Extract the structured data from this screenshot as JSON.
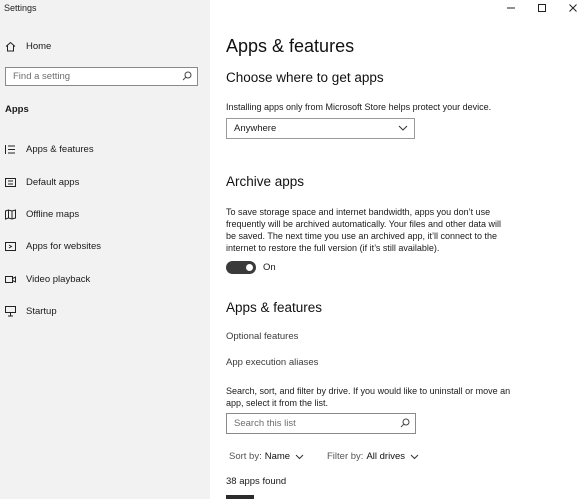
{
  "window": {
    "title": "Settings",
    "controls": [
      "minimize",
      "maximize",
      "close"
    ]
  },
  "sidebar": {
    "home_label": "Home",
    "search_placeholder": "Find a setting",
    "section_label": "Apps",
    "items": [
      {
        "label": "Apps & features",
        "icon": "list-icon"
      },
      {
        "label": "Default apps",
        "icon": "default-apps-icon"
      },
      {
        "label": "Offline maps",
        "icon": "map-icon"
      },
      {
        "label": "Apps for websites",
        "icon": "web-link-icon"
      },
      {
        "label": "Video playback",
        "icon": "video-icon"
      },
      {
        "label": "Startup",
        "icon": "startup-icon"
      }
    ]
  },
  "main": {
    "page_title": "Apps & features",
    "choose": {
      "heading": "Choose where to get apps",
      "description": "Installing apps only from Microsoft Store helps protect your device.",
      "dropdown_value": "Anywhere"
    },
    "archive": {
      "heading": "Archive apps",
      "description_lines": [
        "To save storage space and internet bandwidth, apps you don’t use",
        "frequently will be archived automatically. Your files and other data will",
        "be saved. The next time you use an archived app, it’ll connect to the",
        "internet to restore the full version (if it’s still available)."
      ],
      "toggle_state": "On"
    },
    "apps_features": {
      "heading": "Apps & features",
      "link_optional": "Optional features",
      "link_aliases": "App execution aliases",
      "description_lines": [
        "Search, sort, and filter by drive. If you would like to uninstall or move an",
        "app, select it from the list."
      ],
      "search_placeholder": "Search this list",
      "sort_label": "Sort by:",
      "sort_value": "Name",
      "filter_label": "Filter by:",
      "filter_value": "All drives",
      "apps_count": "38 apps found"
    }
  }
}
